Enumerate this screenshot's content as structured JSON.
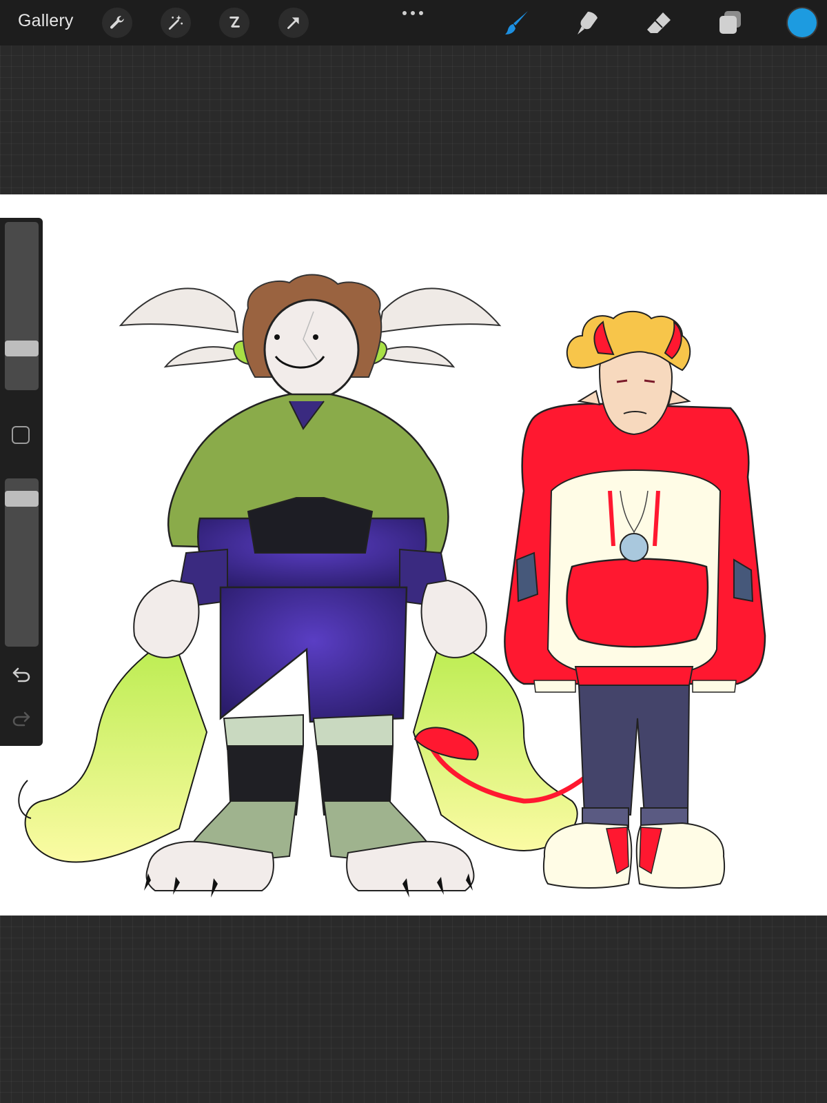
{
  "app": {
    "toolbar": {
      "gallery_label": "Gallery",
      "left_tools": [
        {
          "icon": "wrench-icon",
          "name": "actions"
        },
        {
          "icon": "magic-wand-icon",
          "name": "adjustments"
        },
        {
          "icon": "selection-icon",
          "name": "selection"
        },
        {
          "icon": "arrow-cursor-icon",
          "name": "transform"
        }
      ],
      "more_icon": "ellipsis-icon",
      "right_tools": [
        {
          "icon": "brush-icon",
          "name": "paint",
          "active": true
        },
        {
          "icon": "smudge-icon",
          "name": "smudge"
        },
        {
          "icon": "eraser-icon",
          "name": "erase"
        },
        {
          "icon": "layers-icon",
          "name": "layers"
        }
      ],
      "active_color": "#1d9be0"
    },
    "sidebar": {
      "brush_size_level": 0.75,
      "opacity_level": 0.13,
      "modify_icon": "square-icon",
      "undo_icon": "undo-icon",
      "redo_icon": "redo-icon"
    },
    "canvas": {
      "artwork": "two-character-illustration",
      "colors": {
        "cloak": "#8aab4a",
        "armor": "#3a2a80",
        "flame": "#d6f47a",
        "hoodie": "#ff1830",
        "pocket_panel": "#fffce6",
        "pants": "#44446a",
        "hair": "#f7c54a"
      }
    }
  }
}
